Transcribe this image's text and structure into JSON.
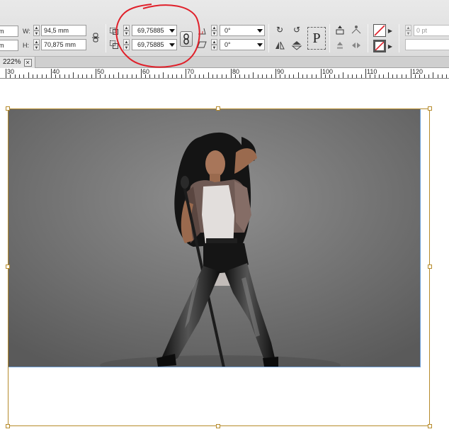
{
  "control_panel": {
    "x_value": "m",
    "y_value": "m",
    "w_label": "W:",
    "w_value": "94,5 mm",
    "h_label": "H:",
    "h_value": "70,875 mm",
    "scale_x_value": "69,75885",
    "scale_y_value": "69,75885",
    "rotate_value": "0°",
    "shear_value": "0°",
    "stroke_weight_placeholder": "0 pt",
    "flip_glyph": "P"
  },
  "document_tab": {
    "zoom_label": "222%"
  },
  "ruler": {
    "labels": [
      "30",
      "40",
      "50",
      "60",
      "70",
      "80",
      "90",
      "100",
      "110",
      "120"
    ]
  },
  "colors": {
    "frame_border": "#b58a2a",
    "image_edge": "#6fa0d8",
    "annotation": "#e0202a"
  },
  "icons": {
    "constrain": "chain-link-icon",
    "rotate_cw": "rotate-clockwise-icon",
    "rotate_ccw": "rotate-counterclockwise-icon",
    "fill": "fill-none-swatch-icon",
    "stroke": "stroke-none-swatch-icon"
  }
}
